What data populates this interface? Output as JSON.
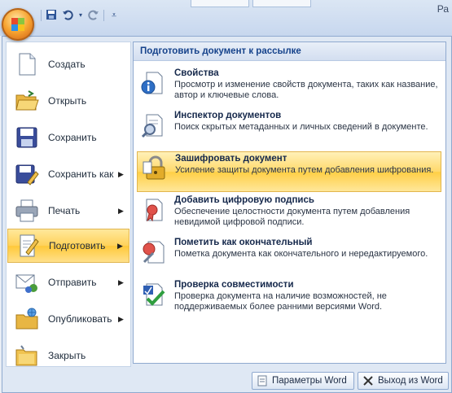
{
  "window": {
    "title_fragment": "Ра"
  },
  "quick_access": {
    "save_icon": "save-icon",
    "undo_icon": "undo-icon",
    "redo_icon": "redo-icon",
    "customize_icon": "customize-icon"
  },
  "left_menu": {
    "items": [
      {
        "label": "Создать",
        "icon": "new-document-icon",
        "has_submenu": false
      },
      {
        "label": "Открыть",
        "icon": "open-folder-icon",
        "has_submenu": false
      },
      {
        "label": "Сохранить",
        "icon": "save-disk-icon",
        "has_submenu": false
      },
      {
        "label": "Сохранить как",
        "icon": "save-as-icon",
        "has_submenu": true
      },
      {
        "label": "Печать",
        "icon": "printer-icon",
        "has_submenu": true
      },
      {
        "label": "Подготовить",
        "icon": "prepare-icon",
        "has_submenu": true,
        "selected": true
      },
      {
        "label": "Отправить",
        "icon": "send-icon",
        "has_submenu": true
      },
      {
        "label": "Опубликовать",
        "icon": "publish-icon",
        "has_submenu": true
      },
      {
        "label": "Закрыть",
        "icon": "close-folder-icon",
        "has_submenu": false
      }
    ]
  },
  "submenu": {
    "header": "Подготовить документ к рассылке",
    "items": [
      {
        "title": "Свойства",
        "desc": "Просмотр и изменение свойств документа, таких как название, автор и ключевые слова.",
        "icon": "properties-icon"
      },
      {
        "title": "Инспектор документов",
        "desc": "Поиск скрытых метаданных и личных сведений в документе.",
        "icon": "inspect-document-icon"
      },
      {
        "title": "Зашифровать документ",
        "desc": "Усиление защиты документа путем добавления шифрования.",
        "icon": "encrypt-lock-icon",
        "selected": true
      },
      {
        "title": "Добавить цифровую подпись",
        "desc": "Обеспечение целостности документа путем добавления невидимой цифровой подписи.",
        "icon": "digital-signature-icon"
      },
      {
        "title": "Пометить как окончательный",
        "desc": "Пометка документа как окончательного и нередактируемого.",
        "icon": "mark-final-icon"
      },
      {
        "title": "Проверка совместимости",
        "desc": "Проверка документа на наличие возможностей, не поддерживаемых более ранними версиями Word.",
        "icon": "compatibility-check-icon"
      }
    ]
  },
  "bottom": {
    "options_label": "Параметры Word",
    "exit_label": "Выход из Word"
  }
}
